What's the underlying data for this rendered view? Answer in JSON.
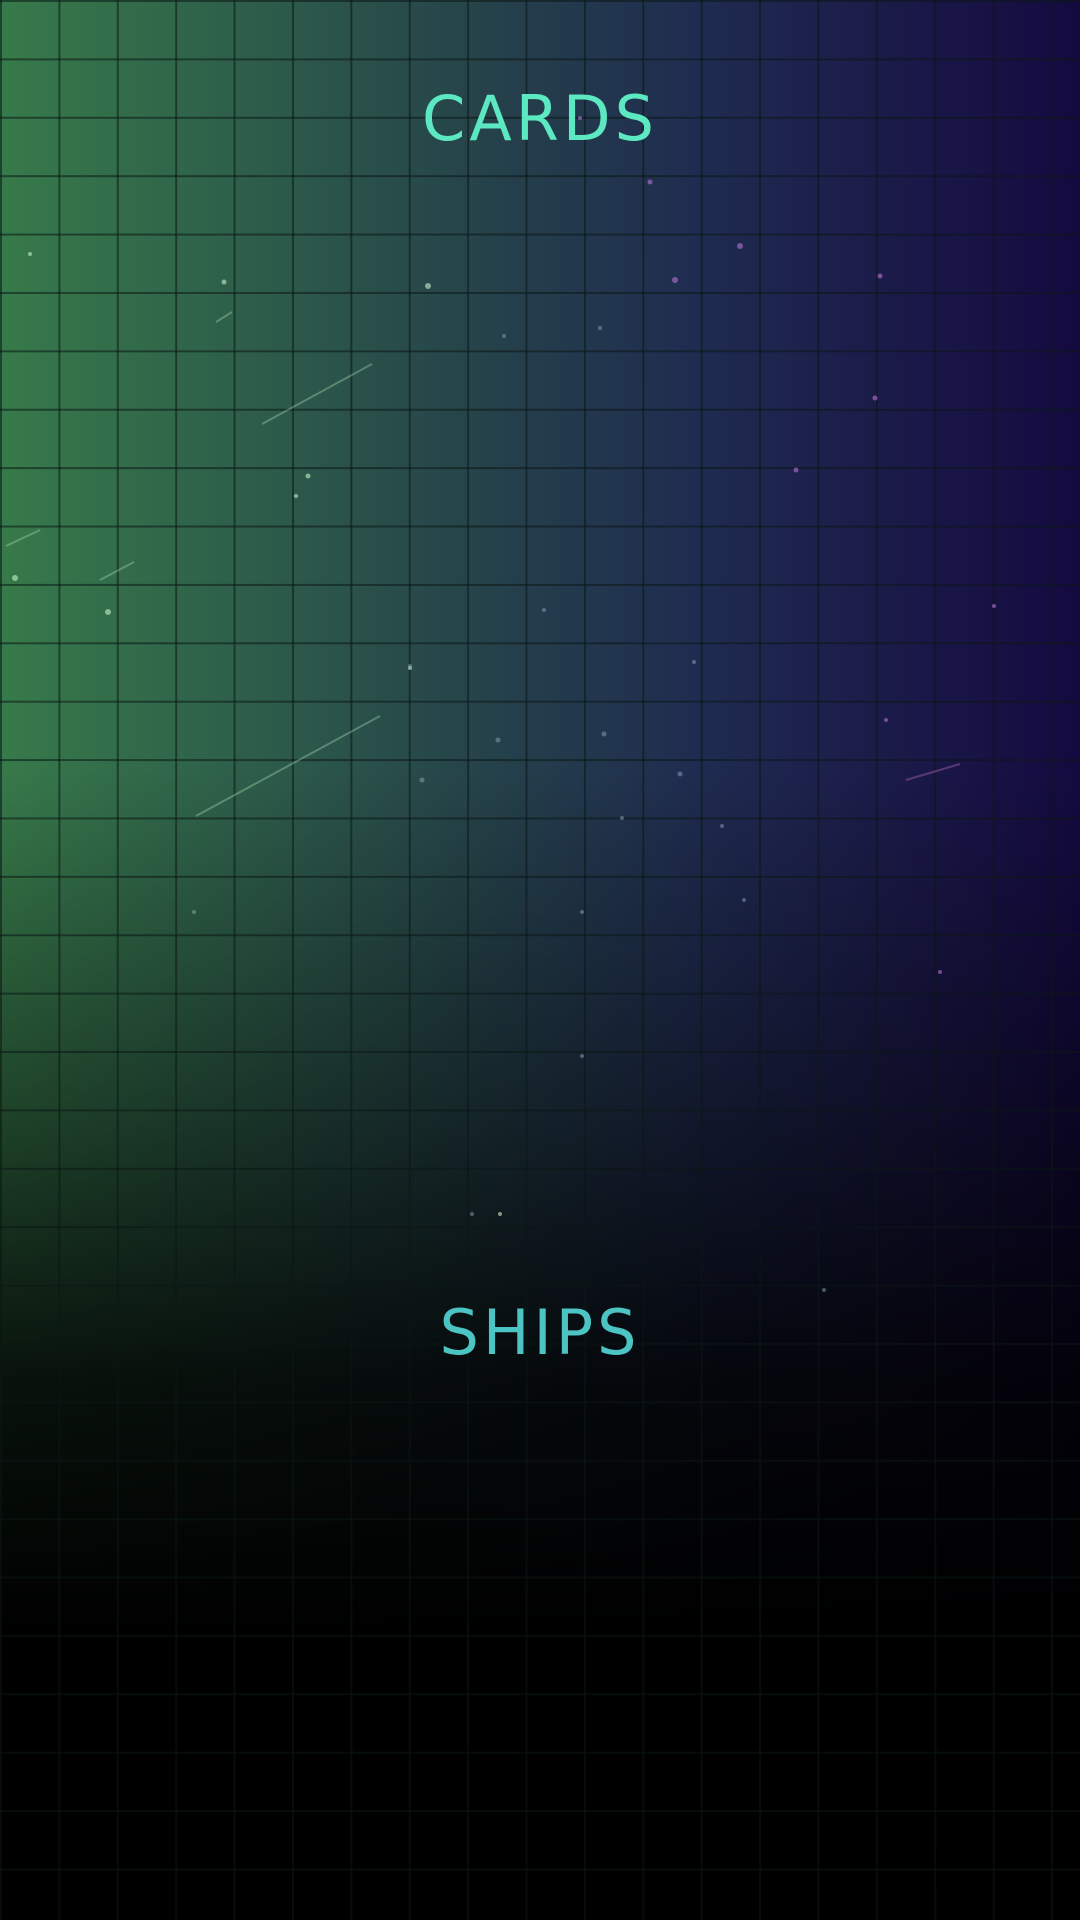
{
  "menu": {
    "cards_label": "CARDS",
    "ships_label": "SHIPS"
  },
  "colors": {
    "cards_text": "#5ce8c0",
    "ships_text": "#4cc4c4",
    "bg_left": "#377a4a",
    "bg_right": "#140a40",
    "bg_bottom": "#000000"
  }
}
